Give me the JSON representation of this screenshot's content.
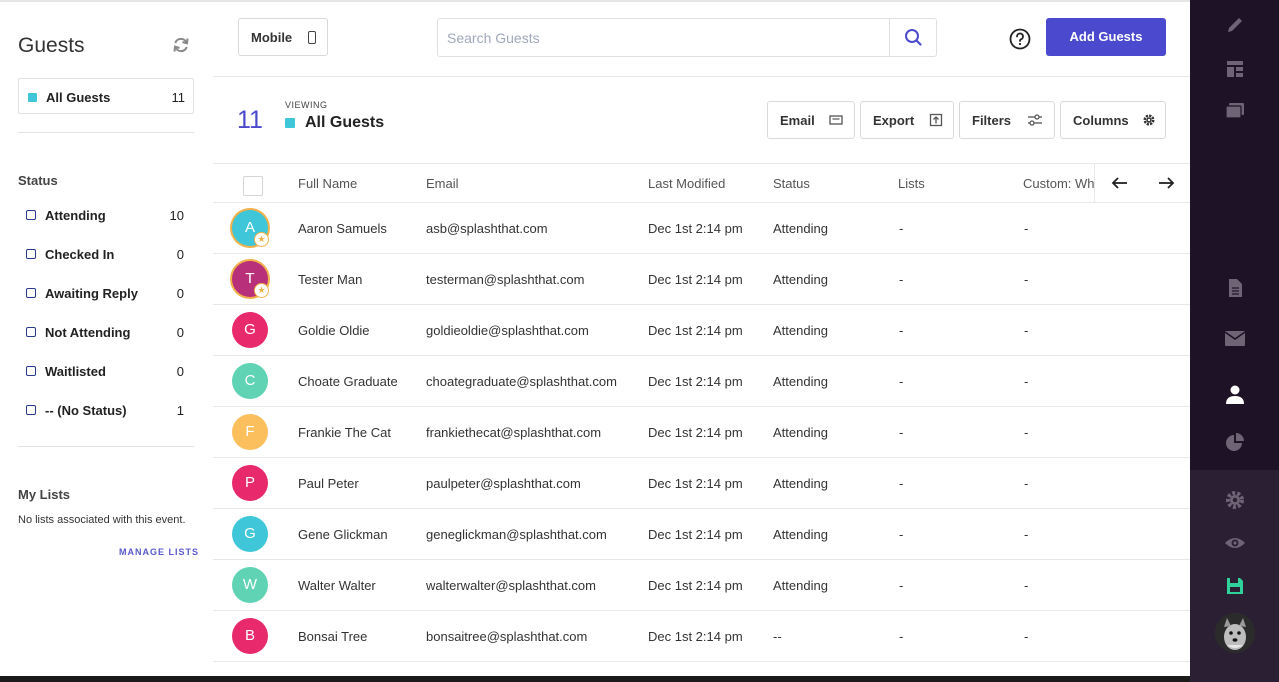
{
  "sidebar": {
    "title": "Guests",
    "all_guests": {
      "label": "All Guests",
      "count": "11"
    },
    "status_heading": "Status",
    "status_items": [
      {
        "label": "Attending",
        "count": "10"
      },
      {
        "label": "Checked In",
        "count": "0"
      },
      {
        "label": "Awaiting Reply",
        "count": "0"
      },
      {
        "label": "Not Attending",
        "count": "0"
      },
      {
        "label": "Waitlisted",
        "count": "0"
      },
      {
        "label": "-- (No Status)",
        "count": "1"
      }
    ],
    "lists_heading": "My Lists",
    "no_lists_text": "No lists associated with this event.",
    "manage_lists_label": "MANAGE LISTS"
  },
  "header": {
    "mobile_label": "Mobile",
    "search_placeholder": "Search Guests",
    "add_guests_label": "Add Guests"
  },
  "viewing": {
    "count": "11",
    "label": "VIEWING",
    "name": "All Guests"
  },
  "toolbar": {
    "email_label": "Email",
    "export_label": "Export",
    "filters_label": "Filters",
    "columns_label": "Columns"
  },
  "table": {
    "columns": [
      "Full Name",
      "Email",
      "Last Modified",
      "Status",
      "Lists",
      "Custom: Wh"
    ],
    "rows": [
      {
        "initial": "A",
        "name": "Aaron Samuels",
        "email": "asb@splashthat.com",
        "modified": "Dec 1st 2:14 pm",
        "status": "Attending",
        "lists": "-",
        "custom": "-",
        "color": "#3fc6d9",
        "starred": true
      },
      {
        "initial": "T",
        "name": "Tester Man",
        "email": "testerman@splashthat.com",
        "modified": "Dec 1st 2:14 pm",
        "status": "Attending",
        "lists": "-",
        "custom": "-",
        "color": "#b8307a",
        "starred": true
      },
      {
        "initial": "G",
        "name": "Goldie Oldie",
        "email": "goldieoldie@splashthat.com",
        "modified": "Dec 1st 2:14 pm",
        "status": "Attending",
        "lists": "-",
        "custom": "-",
        "color": "#e8296b",
        "starred": false
      },
      {
        "initial": "C",
        "name": "Choate Graduate",
        "email": "choategraduate@splashthat.com",
        "modified": "Dec 1st 2:14 pm",
        "status": "Attending",
        "lists": "-",
        "custom": "-",
        "color": "#5fd3b4",
        "starred": false
      },
      {
        "initial": "F",
        "name": "Frankie The Cat",
        "email": "frankiethecat@splashthat.com",
        "modified": "Dec 1st 2:14 pm",
        "status": "Attending",
        "lists": "-",
        "custom": "-",
        "color": "#fbbf5d",
        "starred": false
      },
      {
        "initial": "P",
        "name": "Paul Peter",
        "email": "paulpeter@splashthat.com",
        "modified": "Dec 1st 2:14 pm",
        "status": "Attending",
        "lists": "-",
        "custom": "-",
        "color": "#e8296b",
        "starred": false
      },
      {
        "initial": "G",
        "name": "Gene Glickman",
        "email": "geneglickman@splashthat.com",
        "modified": "Dec 1st 2:14 pm",
        "status": "Attending",
        "lists": "-",
        "custom": "-",
        "color": "#3fc6d9",
        "starred": false
      },
      {
        "initial": "W",
        "name": "Walter Walter",
        "email": "walterwalter@splashthat.com",
        "modified": "Dec 1st 2:14 pm",
        "status": "Attending",
        "lists": "-",
        "custom": "-",
        "color": "#5fd3b4",
        "starred": false
      },
      {
        "initial": "B",
        "name": "Bonsai Tree",
        "email": "bonsaitree@splashthat.com",
        "modified": "Dec 1st 2:14 pm",
        "status": "--",
        "lists": "-",
        "custom": "-",
        "color": "#e8296b",
        "starred": false
      }
    ]
  },
  "rail": {
    "icons": [
      "pencil-icon",
      "layout-icon",
      "gallery-icon",
      "document-icon",
      "mail-icon",
      "person-icon",
      "pie-chart-icon",
      "gear-icon",
      "eye-icon",
      "save-icon"
    ]
  },
  "colors": {
    "accent": "#4b4acf",
    "teal": "#3fc6d9",
    "rail": "#1e1226",
    "save_green": "#2fd29a"
  }
}
